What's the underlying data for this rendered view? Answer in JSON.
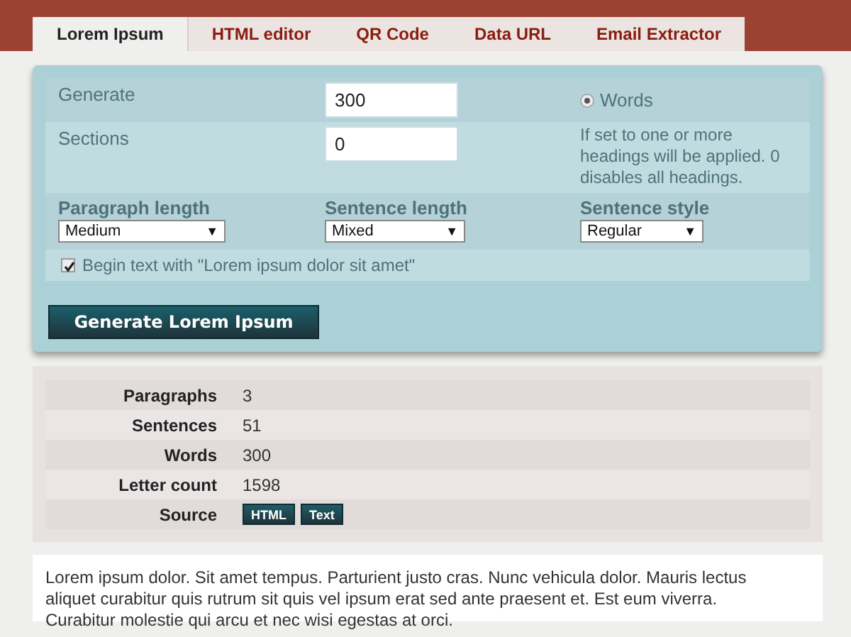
{
  "tabs": [
    {
      "label": "Lorem Ipsum",
      "selected": true
    },
    {
      "label": "HTML editor",
      "selected": false
    },
    {
      "label": "QR Code",
      "selected": false
    },
    {
      "label": "Data URL",
      "selected": false
    },
    {
      "label": "Email Extractor",
      "selected": false
    }
  ],
  "form": {
    "generate": {
      "label": "Generate",
      "value": "300",
      "unit": {
        "label": "Words",
        "selected": true
      }
    },
    "sections": {
      "label": "Sections",
      "value": "0",
      "hint": "If set to one or more headings will be applied. 0 disables all headings."
    },
    "selects": [
      {
        "label": "Paragraph length",
        "value": "Medium",
        "caret": "▼"
      },
      {
        "label": "Sentence length",
        "value": "Mixed",
        "caret": "▼"
      },
      {
        "label": "Sentence style",
        "value": "Regular",
        "caret": "▼"
      }
    ],
    "begin_option": {
      "label": "Begin text with \"Lorem ipsum dolor sit amet\"",
      "checked": true
    },
    "button": "Generate Lorem Ipsum"
  },
  "stats": [
    {
      "label": "Paragraphs",
      "value": "3"
    },
    {
      "label": "Sentences",
      "value": "51"
    },
    {
      "label": "Words",
      "value": "300"
    },
    {
      "label": "Letter count",
      "value": "1598"
    },
    {
      "label": "Source",
      "buttons": [
        "HTML",
        "Text"
      ]
    }
  ],
  "output": "Lorem ipsum dolor. Sit amet tempus. Parturient justo cras. Nunc vehicula dolor. Mauris lectus aliquet curabitur quis rutrum sit quis vel ipsum erat sed ante praesent et. Est eum viverra. Curabitur molestie qui arcu et nec wisi egestas at orci."
}
